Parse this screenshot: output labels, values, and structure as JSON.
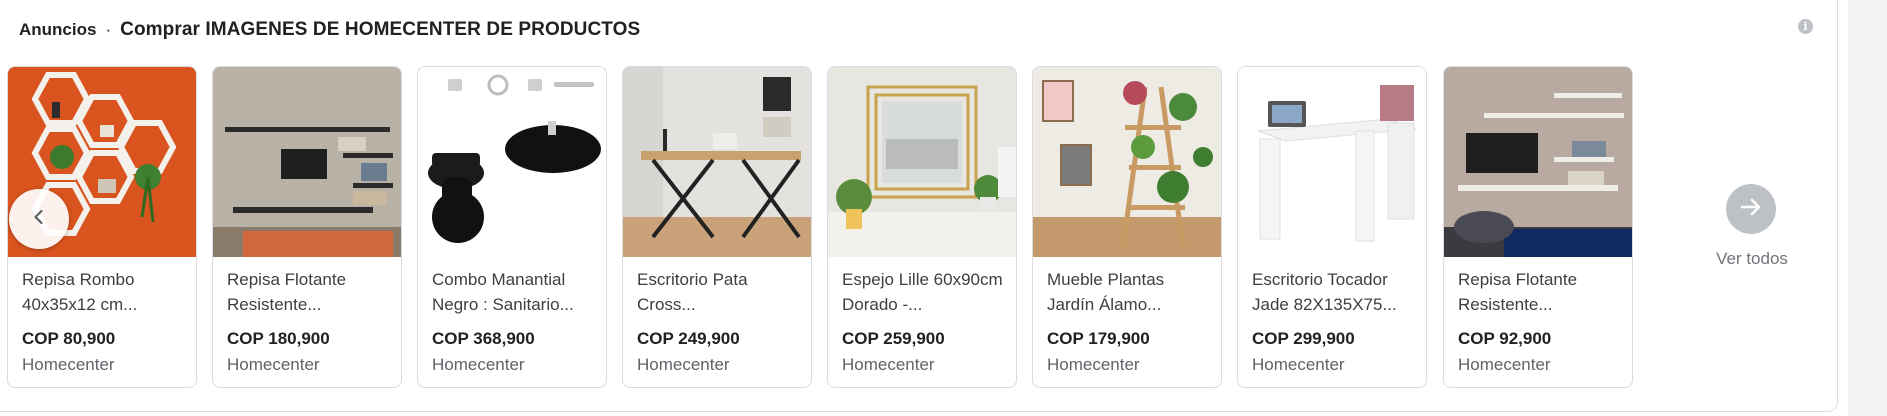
{
  "header": {
    "ads_label": "Anuncios",
    "separator": "·",
    "title": "Comprar IMAGENES DE HOMECENTER DE PRODUCTOS"
  },
  "info_icon": "info-icon",
  "products": [
    {
      "title": "Repisa Rombo 40x35x12 cm...",
      "price": "COP 80,900",
      "seller": "Homecenter",
      "image": "hexagon-shelves-orange-wall"
    },
    {
      "title": "Repisa Flotante Resistente...",
      "price": "COP 180,900",
      "seller": "Homecenter",
      "image": "floating-shelves-tv-wall"
    },
    {
      "title": "Combo Manantial Negro : Sanitario...",
      "price": "COP 368,900",
      "seller": "Homecenter",
      "image": "black-toilet-sink-combo"
    },
    {
      "title": "Escritorio Pata Cross...",
      "price": "COP 249,900",
      "seller": "Homecenter",
      "image": "desk-cross-legs"
    },
    {
      "title": "Espejo Lille 60x90cm Dorado -...",
      "price": "COP 259,900",
      "seller": "Homecenter",
      "image": "gold-frame-mirror"
    },
    {
      "title": "Mueble Plantas Jardín Álamo...",
      "price": "COP 179,900",
      "seller": "Homecenter",
      "image": "wooden-plant-ladder"
    },
    {
      "title": "Escritorio Tocador Jade 82X135X75...",
      "price": "COP 299,900",
      "seller": "Homecenter",
      "image": "white-corner-desk"
    },
    {
      "title": "Repisa Flotante Resistente...",
      "price": "COP 92,900",
      "seller": "Homecenter",
      "image": "floating-shelves-tv-wall-dark"
    }
  ],
  "nav": {
    "prev_icon": "chevron-left-icon",
    "next_icon": "arrow-right-icon",
    "see_all": "Ver todos"
  },
  "colors": {
    "price": "#202124",
    "seller": "#5f6368",
    "border": "#dadce0",
    "next_button": "#bdc1c6"
  }
}
